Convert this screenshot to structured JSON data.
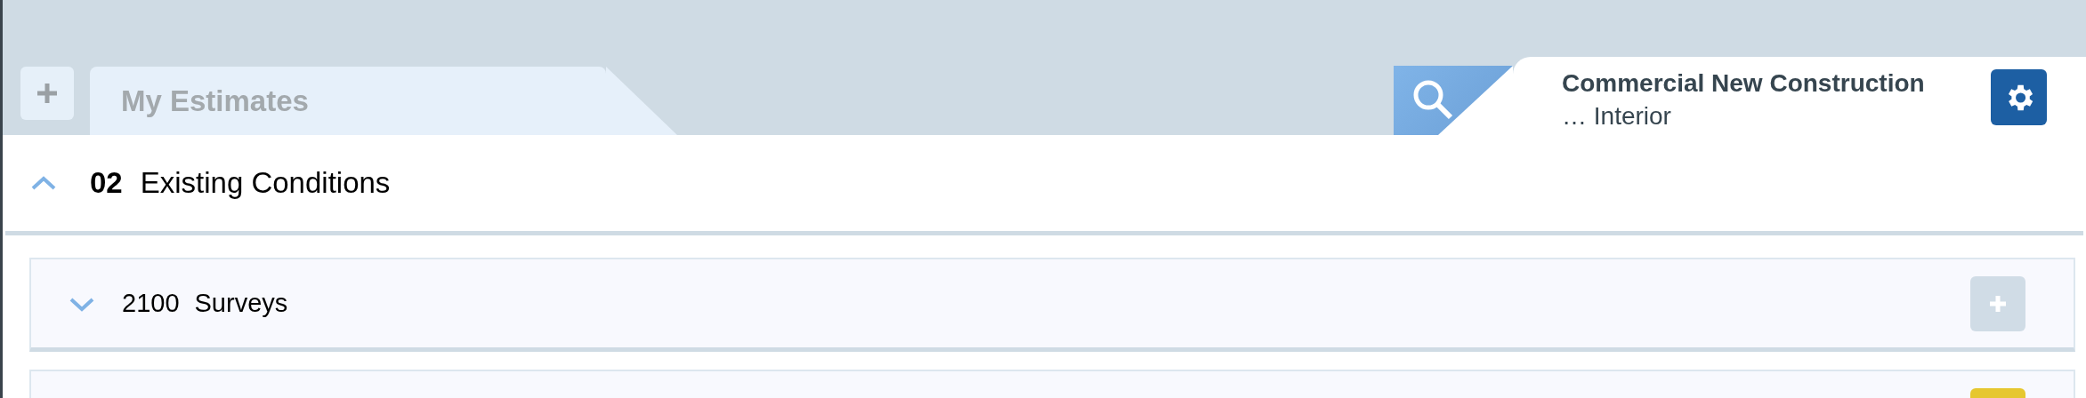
{
  "tabs": [
    {
      "label": "My Estimates",
      "selected": false
    }
  ],
  "project": {
    "title": "Commercial New Construction",
    "subtitle": "… Interior"
  },
  "section": {
    "number": "02",
    "name": "Existing Conditions",
    "expanded": true
  },
  "rows": [
    {
      "code": "2100",
      "name": "Surveys",
      "expanded": false,
      "color": "#d0dce6"
    },
    {
      "color": "#e6c72f"
    }
  ]
}
